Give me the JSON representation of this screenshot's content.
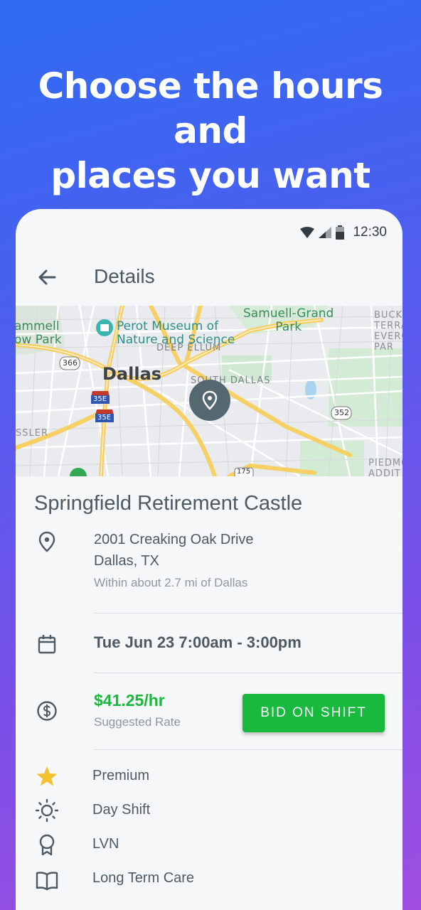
{
  "headline": {
    "line1": "Choose the hours and",
    "line2": "places you want"
  },
  "status_bar": {
    "time": "12:30",
    "icons": [
      "wifi-icon",
      "signal-icon",
      "battery-icon"
    ]
  },
  "app_bar": {
    "back_icon": "arrow-back-icon",
    "title": "Details"
  },
  "map": {
    "labels": {
      "park_left": [
        "ammell",
        "ow Park"
      ],
      "museum": [
        "Perot Museum of",
        "Nature and Science"
      ],
      "park_top": [
        "Samuell-Grand",
        "Park"
      ],
      "edge_top_right": [
        "BUCK",
        "TERRA",
        "EVERG",
        "PAR"
      ],
      "district_deep_ellum": "DEEP ELLUM",
      "city": "Dallas",
      "district_south": "SOUTH DALLAS",
      "edge_left": "SSLER",
      "edge_bottom_right": [
        "PIEDMO",
        "ADDIT"
      ],
      "shield_366": "366",
      "shield_35e_top": "35E",
      "shield_35e_bottom": "35E",
      "shield_352": "352",
      "shield_175": "175"
    },
    "pin_icon": "location-pin-icon"
  },
  "shift": {
    "facility": "Springfield Retirement Castle",
    "address_line1": "2001 Creaking Oak Drive",
    "address_line2": "Dallas, TX",
    "distance": "Within about 2.7 mi of Dallas",
    "datetime": "Tue Jun 23 7:00am - 3:00pm",
    "rate": "$41.25/hr",
    "rate_label": "Suggested Rate",
    "bid_button": "BID ON SHIFT",
    "tags": [
      {
        "icon": "star-icon",
        "label": "Premium"
      },
      {
        "icon": "sun-icon",
        "label": "Day Shift"
      },
      {
        "icon": "badge-icon",
        "label": "LVN"
      },
      {
        "icon": "book-icon",
        "label": "Long Term Care"
      }
    ]
  },
  "colors": {
    "accent_green": "#18b93c",
    "star_yellow": "#f3c230",
    "text_primary": "#4d5a63",
    "gradient_top": "#2f6cf2",
    "gradient_bottom": "#a04ee0"
  }
}
